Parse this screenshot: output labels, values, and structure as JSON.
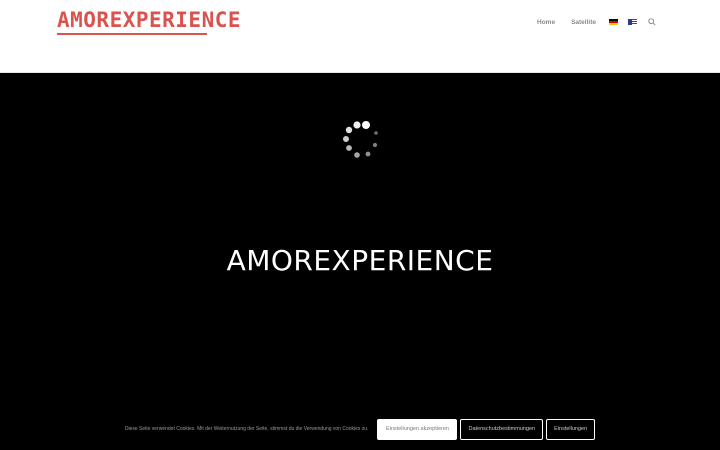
{
  "header": {
    "logo_text": "AMOREXPERIENCE",
    "logo_color": "#d9534f",
    "nav": [
      {
        "label": "Home"
      },
      {
        "label": "Satellite"
      }
    ],
    "flags": [
      "german-flag-icon",
      "english-flag-icon"
    ],
    "search_icon": "search-icon"
  },
  "hero": {
    "title": "AMOREXPERIENCE",
    "loader_icon": "loading-spinner-icon"
  },
  "cookie": {
    "text": "Diese Seite verwendet Cookies. Mit der Weiternutzung der Seite, stimmst du die Verwendung von Cookies zu.",
    "accept_label": "Einstellungen akzeptieren",
    "privacy_label": "Datenschutzbestimmungen",
    "settings_label": "Einstellungen"
  }
}
